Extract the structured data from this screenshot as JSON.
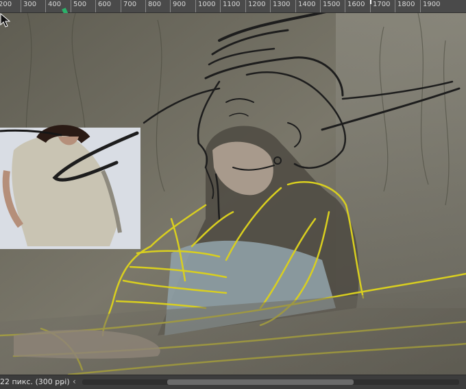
{
  "ruler": {
    "units": [
      "200",
      "300",
      "400",
      "500",
      "600",
      "700",
      "800",
      "900",
      "1000",
      "1100",
      "1200",
      "1300",
      "1400",
      "1500",
      "1600",
      "1700",
      "1800",
      "1900"
    ]
  },
  "status": {
    "zoom_text": "22 пикс. (300 ppi)",
    "nav_next": "›",
    "nav_prev": "‹"
  },
  "colors": {
    "sketch_yellow": "#d9cf1f",
    "ink": "#1d1d1d",
    "photo_bg": "#6c6a5d"
  },
  "icons": {
    "cursor": "arrow-cursor-icon"
  }
}
